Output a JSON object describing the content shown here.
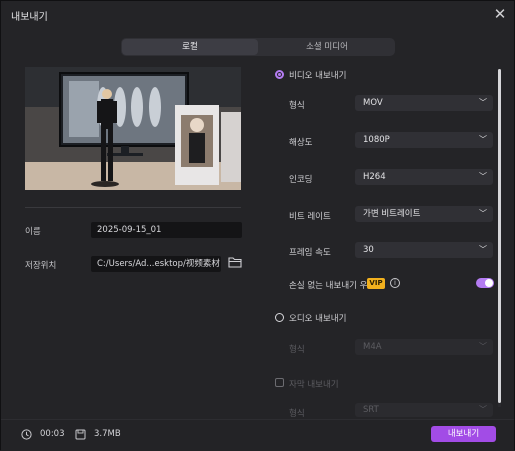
{
  "window": {
    "title": "내보내기"
  },
  "tabs": [
    {
      "label": "로컬",
      "active": true
    },
    {
      "label": "소셜 미디어",
      "active": false
    }
  ],
  "file": {
    "name_label": "이름",
    "name_value": "2025-09-15_01",
    "location_label": "저장위치",
    "location_value": "C:/Users/Ad...esktop/视频素材"
  },
  "video": {
    "section_label": "비디오 내보내기",
    "selected": true,
    "format_label": "형식",
    "format_value": "MOV",
    "resolution_label": "해상도",
    "resolution_value": "1080P",
    "encoder_label": "인코딩",
    "encoder_value": "H264",
    "bitrate_label": "비트 레이트",
    "bitrate_value": "가변 비트레이트",
    "framerate_label": "프레임 속도",
    "framerate_value": "30",
    "lossless_label": "손실 없는 내보내기 우선",
    "vip_badge": "VIP",
    "lossless_enabled": true
  },
  "audio": {
    "section_label": "오디오 내보내기",
    "selected": false,
    "format_label": "형식",
    "format_value": "M4A"
  },
  "subtitle": {
    "checkbox_label": "자막 내보내기",
    "checked": false,
    "format_label": "형식",
    "format_value": "SRT"
  },
  "footer": {
    "duration": "00:03",
    "size": "3.7MB",
    "export_label": "내보내기"
  },
  "colors": {
    "accent": "#b47cf2",
    "export_button": "#a24ce6",
    "vip": "#f2b11e"
  }
}
